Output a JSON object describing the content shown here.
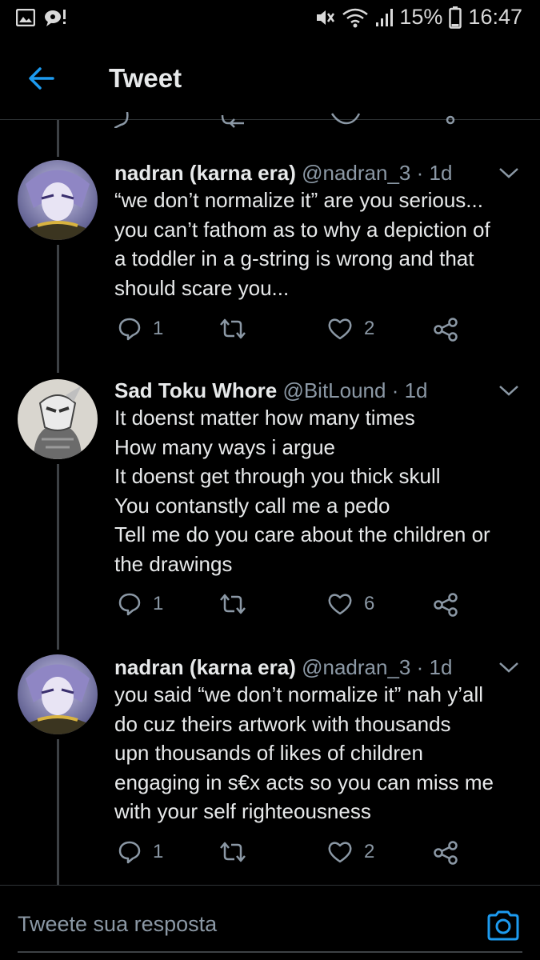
{
  "status_bar": {
    "battery": "15%",
    "time": "16:47"
  },
  "header": {
    "title": "Tweet"
  },
  "tweets": [
    {
      "name": "nadran (karna era)",
      "handle": "@nadran_3",
      "age": "· 1d",
      "lines": [
        "“we don’t normalize it” are you serious...",
        "you can’t fathom as to why a depiction of",
        "a toddler in a g-string is wrong and that",
        "should scare you..."
      ],
      "replies": "1",
      "likes": "2"
    },
    {
      "name": "Sad Toku Whore",
      "handle": "@BitLound",
      "age": "· 1d",
      "lines": [
        "It doenst matter how many times",
        "How many ways i argue",
        "It doenst get through you thick skull",
        "You contanstly call me a pedo",
        "Tell me do you care about the children or",
        "the drawings"
      ],
      "replies": "1",
      "likes": "6"
    },
    {
      "name": "nadran (karna era)",
      "handle": "@nadran_3",
      "age": "· 1d",
      "lines": [
        "you said “we don’t normalize it” nah y’all",
        "do cuz theirs artwork with thousands",
        "upn thousands of likes of children",
        "engaging in s€x acts so you can miss me",
        "with your self righteousness"
      ],
      "replies": "1",
      "likes": "2"
    }
  ],
  "compose": {
    "placeholder": "Tweete sua resposta"
  },
  "colors": {
    "accent": "#1d9bf0",
    "muted": "#8b98a5",
    "text": "#e7e9ea"
  }
}
